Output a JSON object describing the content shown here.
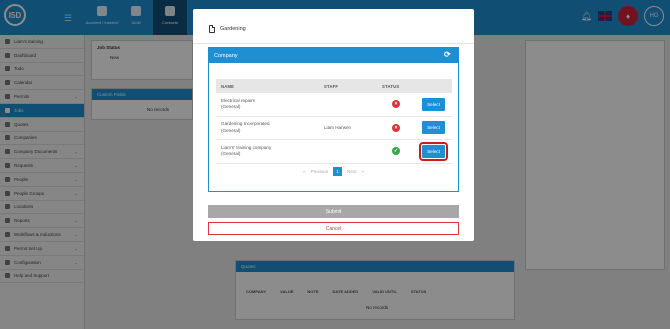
{
  "app": {
    "logo_text": "I5D",
    "topnav": [
      {
        "label": "Accident / Incident"
      },
      {
        "label": "Audit"
      },
      {
        "label": "Contacts"
      }
    ],
    "avatar_initials": "HG"
  },
  "sidebar": {
    "items": [
      {
        "label": "Liam's training",
        "icon": "user-icon",
        "chevron": ""
      },
      {
        "label": "Dashboard",
        "icon": "dashboard-icon",
        "chevron": ""
      },
      {
        "label": "Todo",
        "icon": "todo-icon",
        "chevron": ""
      },
      {
        "label": "Calendar",
        "icon": "calendar-icon",
        "chevron": ""
      },
      {
        "label": "Permits",
        "icon": "permit-icon",
        "chevron": "⌄"
      },
      {
        "label": "Jobs",
        "icon": "jobs-icon",
        "chevron": ""
      },
      {
        "label": "Quotes",
        "icon": "quotes-icon",
        "chevron": ""
      },
      {
        "label": "Companies",
        "icon": "companies-icon",
        "chevron": ""
      },
      {
        "label": "Company Documents",
        "icon": "documents-icon",
        "chevron": "⌄"
      },
      {
        "label": "Requests",
        "icon": "requests-icon",
        "chevron": "⌄"
      },
      {
        "label": "People",
        "icon": "people-icon",
        "chevron": "⌄"
      },
      {
        "label": "People Groups",
        "icon": "groups-icon",
        "chevron": "⌄"
      },
      {
        "label": "Locations",
        "icon": "location-icon",
        "chevron": ""
      },
      {
        "label": "Reports",
        "icon": "reports-icon",
        "chevron": "⌄"
      },
      {
        "label": "Workflows & Inductions",
        "icon": "workflow-icon",
        "chevron": "⌄"
      },
      {
        "label": "Permit Set Up",
        "icon": "setup-icon",
        "chevron": "⌄"
      },
      {
        "label": "Configuration",
        "icon": "gear-icon",
        "chevron": "⌄"
      },
      {
        "label": "Help and Support",
        "icon": "help-icon",
        "chevron": ""
      }
    ]
  },
  "background": {
    "job_status_label": "Job Status",
    "job_status_value": "New",
    "custom_fields_title": "Custom Fields",
    "no_records": "No records",
    "quotes_title": "Quotes",
    "quotes_columns": [
      "COMPANY",
      "VALUE",
      "NOTE",
      "DATE ADDED",
      "VALID UNTIL",
      "STATUS"
    ]
  },
  "modal": {
    "title": "Gardening",
    "panel_title": "Company",
    "columns": {
      "name": "NAME",
      "staff": "STAFF",
      "status": "STATUS"
    },
    "rows": [
      {
        "name_line1": "Electrical repairs",
        "name_line2": "(General)",
        "staff": "",
        "status": "inactive",
        "action": "Select"
      },
      {
        "name_line1": "Gardening Incorporated",
        "name_line2": "(General)",
        "staff": "Liam Hansen",
        "status": "inactive",
        "action": "Select"
      },
      {
        "name_line1": "Liam's' training company",
        "name_line2": "(General)",
        "staff": "",
        "status": "active",
        "action": "Select"
      }
    ],
    "pager": {
      "prev_first": "«",
      "prev": "Previous",
      "current": "1",
      "next": "Next",
      "next_last": "»"
    },
    "submit_label": "Submit",
    "cancel_label": "Cancel"
  },
  "colors": {
    "accent": "#1f8fd4",
    "danger": "#d9363e",
    "success": "#3aa64b"
  }
}
